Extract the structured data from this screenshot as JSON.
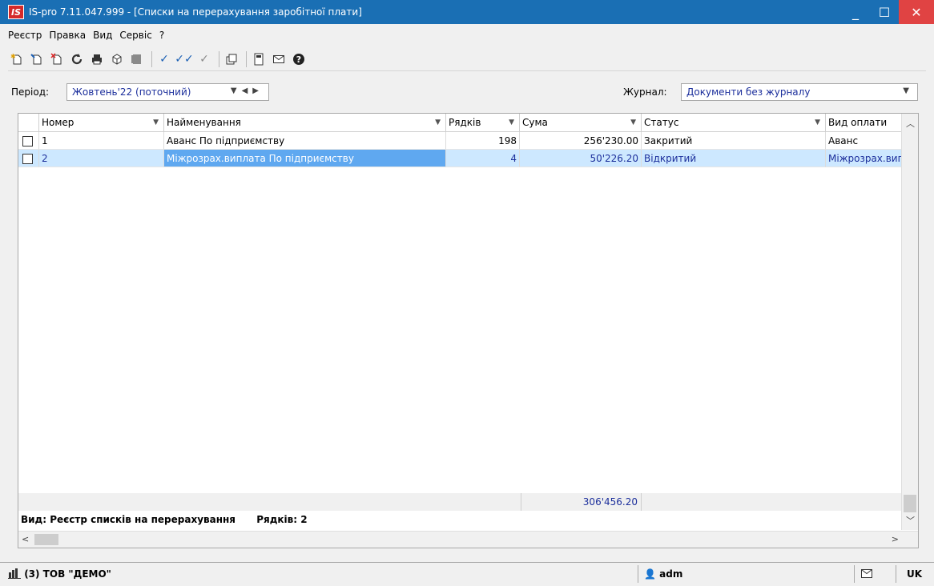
{
  "window": {
    "app_icon": "IS",
    "title": "IS-pro 7.11.047.999 - [Списки на перерахування заробітної плати]",
    "minimize": "_",
    "maximize": "☐",
    "close": "✕"
  },
  "menu": [
    "Реєстр",
    "Правка",
    "Вид",
    "Сервіс",
    "?"
  ],
  "toolbar": {
    "icons": [
      "new-document-icon",
      "edit-document-icon",
      "delete-document-icon",
      "refresh-icon",
      "print-icon",
      "package-icon",
      "archive-icon",
      "check-icon",
      "double-check-icon",
      "uncheck-icon",
      "copy-icon",
      "calculator-icon",
      "mail-icon",
      "help-icon"
    ]
  },
  "filters": {
    "period_label": "Період:",
    "period_value": "Жовтень'22 (поточний)",
    "journal_label": "Журнал:",
    "journal_value": "Документи без журналу"
  },
  "table": {
    "columns": [
      "Номер",
      "Найменування",
      "Рядків",
      "Сума",
      "Статус",
      "Вид оплати"
    ],
    "rows": [
      {
        "number": "1",
        "name": "Аванс По підприємству",
        "rows_count": "198",
        "sum": "256'230.00",
        "status": "Закритий",
        "payment_type": "Аванс"
      },
      {
        "number": "2",
        "name": "Міжрозрах.виплата По підприємству",
        "rows_count": "4",
        "sum": "50'226.20",
        "status": "Відкритий",
        "payment_type": "Міжрозрах.вип"
      }
    ],
    "total_sum": "306'456.20",
    "view_label": "Вид: Реєстр списків на перерахування",
    "rows_label": "Рядків: 2"
  },
  "statusbar": {
    "company": "(3) ТОВ \"ДЕМО\"",
    "user": "adm",
    "lang": "UK"
  }
}
